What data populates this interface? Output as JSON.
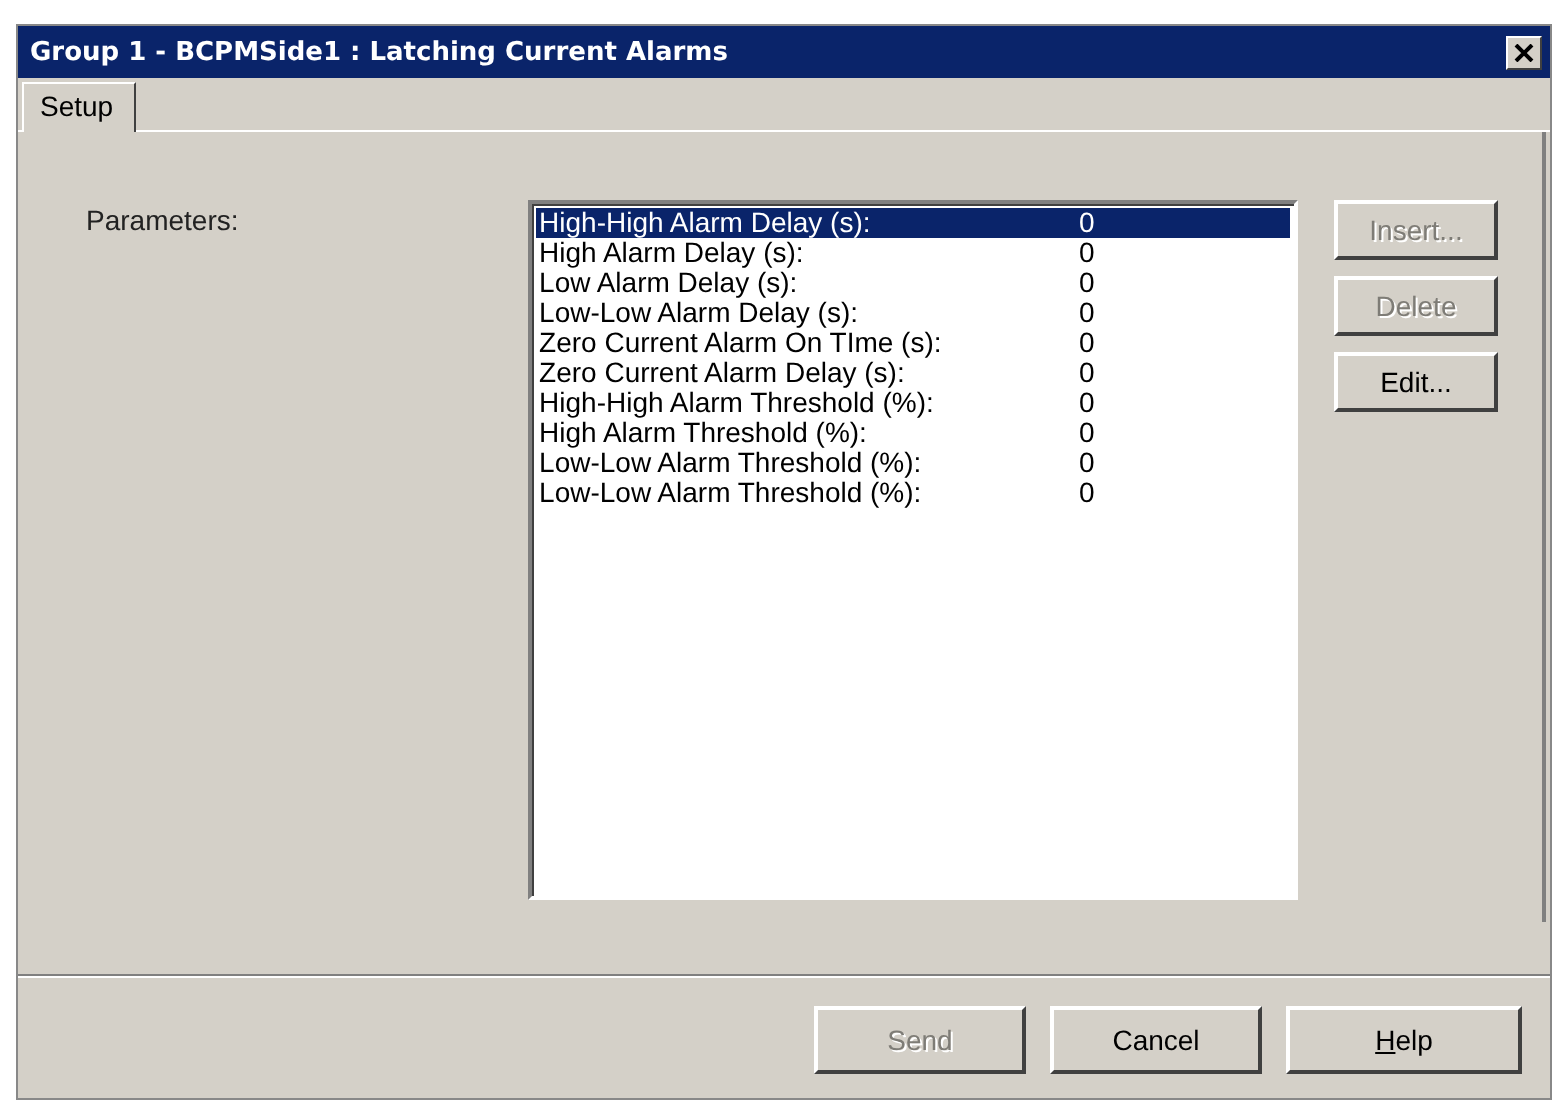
{
  "window": {
    "title": "Group 1 - BCPMSide1 : Latching Current Alarms"
  },
  "tabs": [
    {
      "label": "Setup",
      "selected": true
    }
  ],
  "parameters": {
    "label": "Parameters:",
    "rows": [
      {
        "name": "High-High Alarm Delay (s):",
        "value": "0",
        "selected": true
      },
      {
        "name": "High Alarm Delay (s):",
        "value": "0",
        "selected": false
      },
      {
        "name": "Low Alarm Delay (s):",
        "value": "0",
        "selected": false
      },
      {
        "name": "Low-Low Alarm Delay (s):",
        "value": "0",
        "selected": false
      },
      {
        "name": "Zero Current Alarm On TIme (s):",
        "value": "0",
        "selected": false
      },
      {
        "name": "Zero Current Alarm Delay (s):",
        "value": "0",
        "selected": false
      },
      {
        "name": "High-High Alarm Threshold (%):",
        "value": "0",
        "selected": false
      },
      {
        "name": "High Alarm Threshold (%):",
        "value": "0",
        "selected": false
      },
      {
        "name": "Low-Low Alarm Threshold (%):",
        "value": "0",
        "selected": false
      },
      {
        "name": "Low-Low Alarm Threshold (%):",
        "value": "0",
        "selected": false
      }
    ]
  },
  "side_buttons": [
    {
      "label": "Insert...",
      "disabled": true
    },
    {
      "label": "Delete",
      "disabled": true
    },
    {
      "label": "Edit...",
      "disabled": false
    }
  ],
  "buttons": [
    {
      "label": "Send",
      "disabled": true,
      "mnemonic": false
    },
    {
      "label": "Cancel",
      "disabled": false,
      "mnemonic": false
    },
    {
      "label": "Help",
      "disabled": false,
      "mnemonic": true
    }
  ]
}
